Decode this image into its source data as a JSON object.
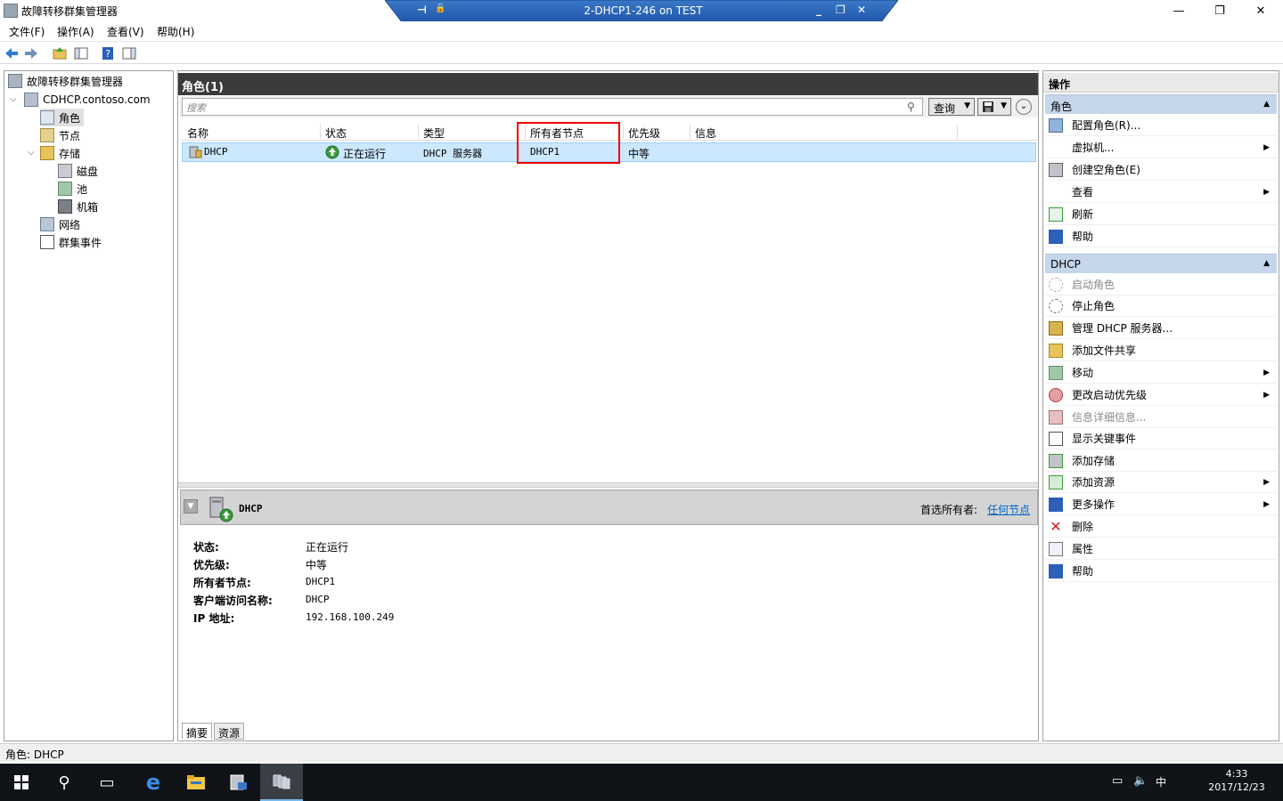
{
  "window": {
    "title": "故障转移群集管理器",
    "minimize": "—",
    "maximize": "❐",
    "close": "✕"
  },
  "rdp": {
    "title": "2-DHCP1-246 on TEST",
    "pin": "⊣",
    "lock": "🔒",
    "minimize": "_",
    "restore": "❐",
    "close": "✕"
  },
  "menu": [
    "文件(F)",
    "操作(A)",
    "查看(V)",
    "帮助(H)"
  ],
  "tree": {
    "root": "故障转移群集管理器",
    "cluster": "CDHCP.contoso.com",
    "roles": "角色",
    "nodes": "节点",
    "storage": "存储",
    "disks": "磁盘",
    "pools": "池",
    "enclosures": "机箱",
    "networks": "网络",
    "cluster_events": "群集事件"
  },
  "center": {
    "header": "角色(1)",
    "search_placeholder": "搜索",
    "query_label": "查询",
    "columns": [
      "名称",
      "状态",
      "类型",
      "所有者节点",
      "优先级",
      "信息"
    ],
    "row": {
      "name": "DHCP",
      "status": "正在运行",
      "type": "DHCP 服务器",
      "owner": "DHCP1",
      "priority": "中等",
      "info": ""
    }
  },
  "detail": {
    "name": "DHCP",
    "preferred_owners_label": "首选所有者:",
    "preferred_owners_link": "任何节点",
    "props": [
      {
        "label": "状态:",
        "value": "正在运行"
      },
      {
        "label": "优先级:",
        "value": "中等"
      },
      {
        "label": "所有者节点:",
        "value": "DHCP1"
      },
      {
        "label": "客户端访问名称:",
        "value": "DHCP"
      },
      {
        "label": "IP 地址:",
        "value": "192.168.100.249"
      }
    ],
    "tabs": [
      "摘要",
      "资源"
    ]
  },
  "actions": {
    "title": "操作",
    "section_roles": "角色",
    "roles_items": [
      "配置角色(R)...",
      "虚拟机...",
      "创建空角色(E)",
      "查看",
      "刷新",
      "帮助"
    ],
    "section_dhcp": "DHCP",
    "dhcp_items": [
      "启动角色",
      "停止角色",
      "管理 DHCP 服务器...",
      "添加文件共享",
      "移动",
      "更改启动优先级",
      "信息详细信息...",
      "显示关键事件",
      "添加存储",
      "添加资源",
      "更多操作",
      "删除",
      "属性",
      "帮助"
    ]
  },
  "status": "角色: DHCP",
  "taskbar": {
    "clock_time": "4:33",
    "clock_date": "2017/12/23",
    "ime": "中"
  }
}
